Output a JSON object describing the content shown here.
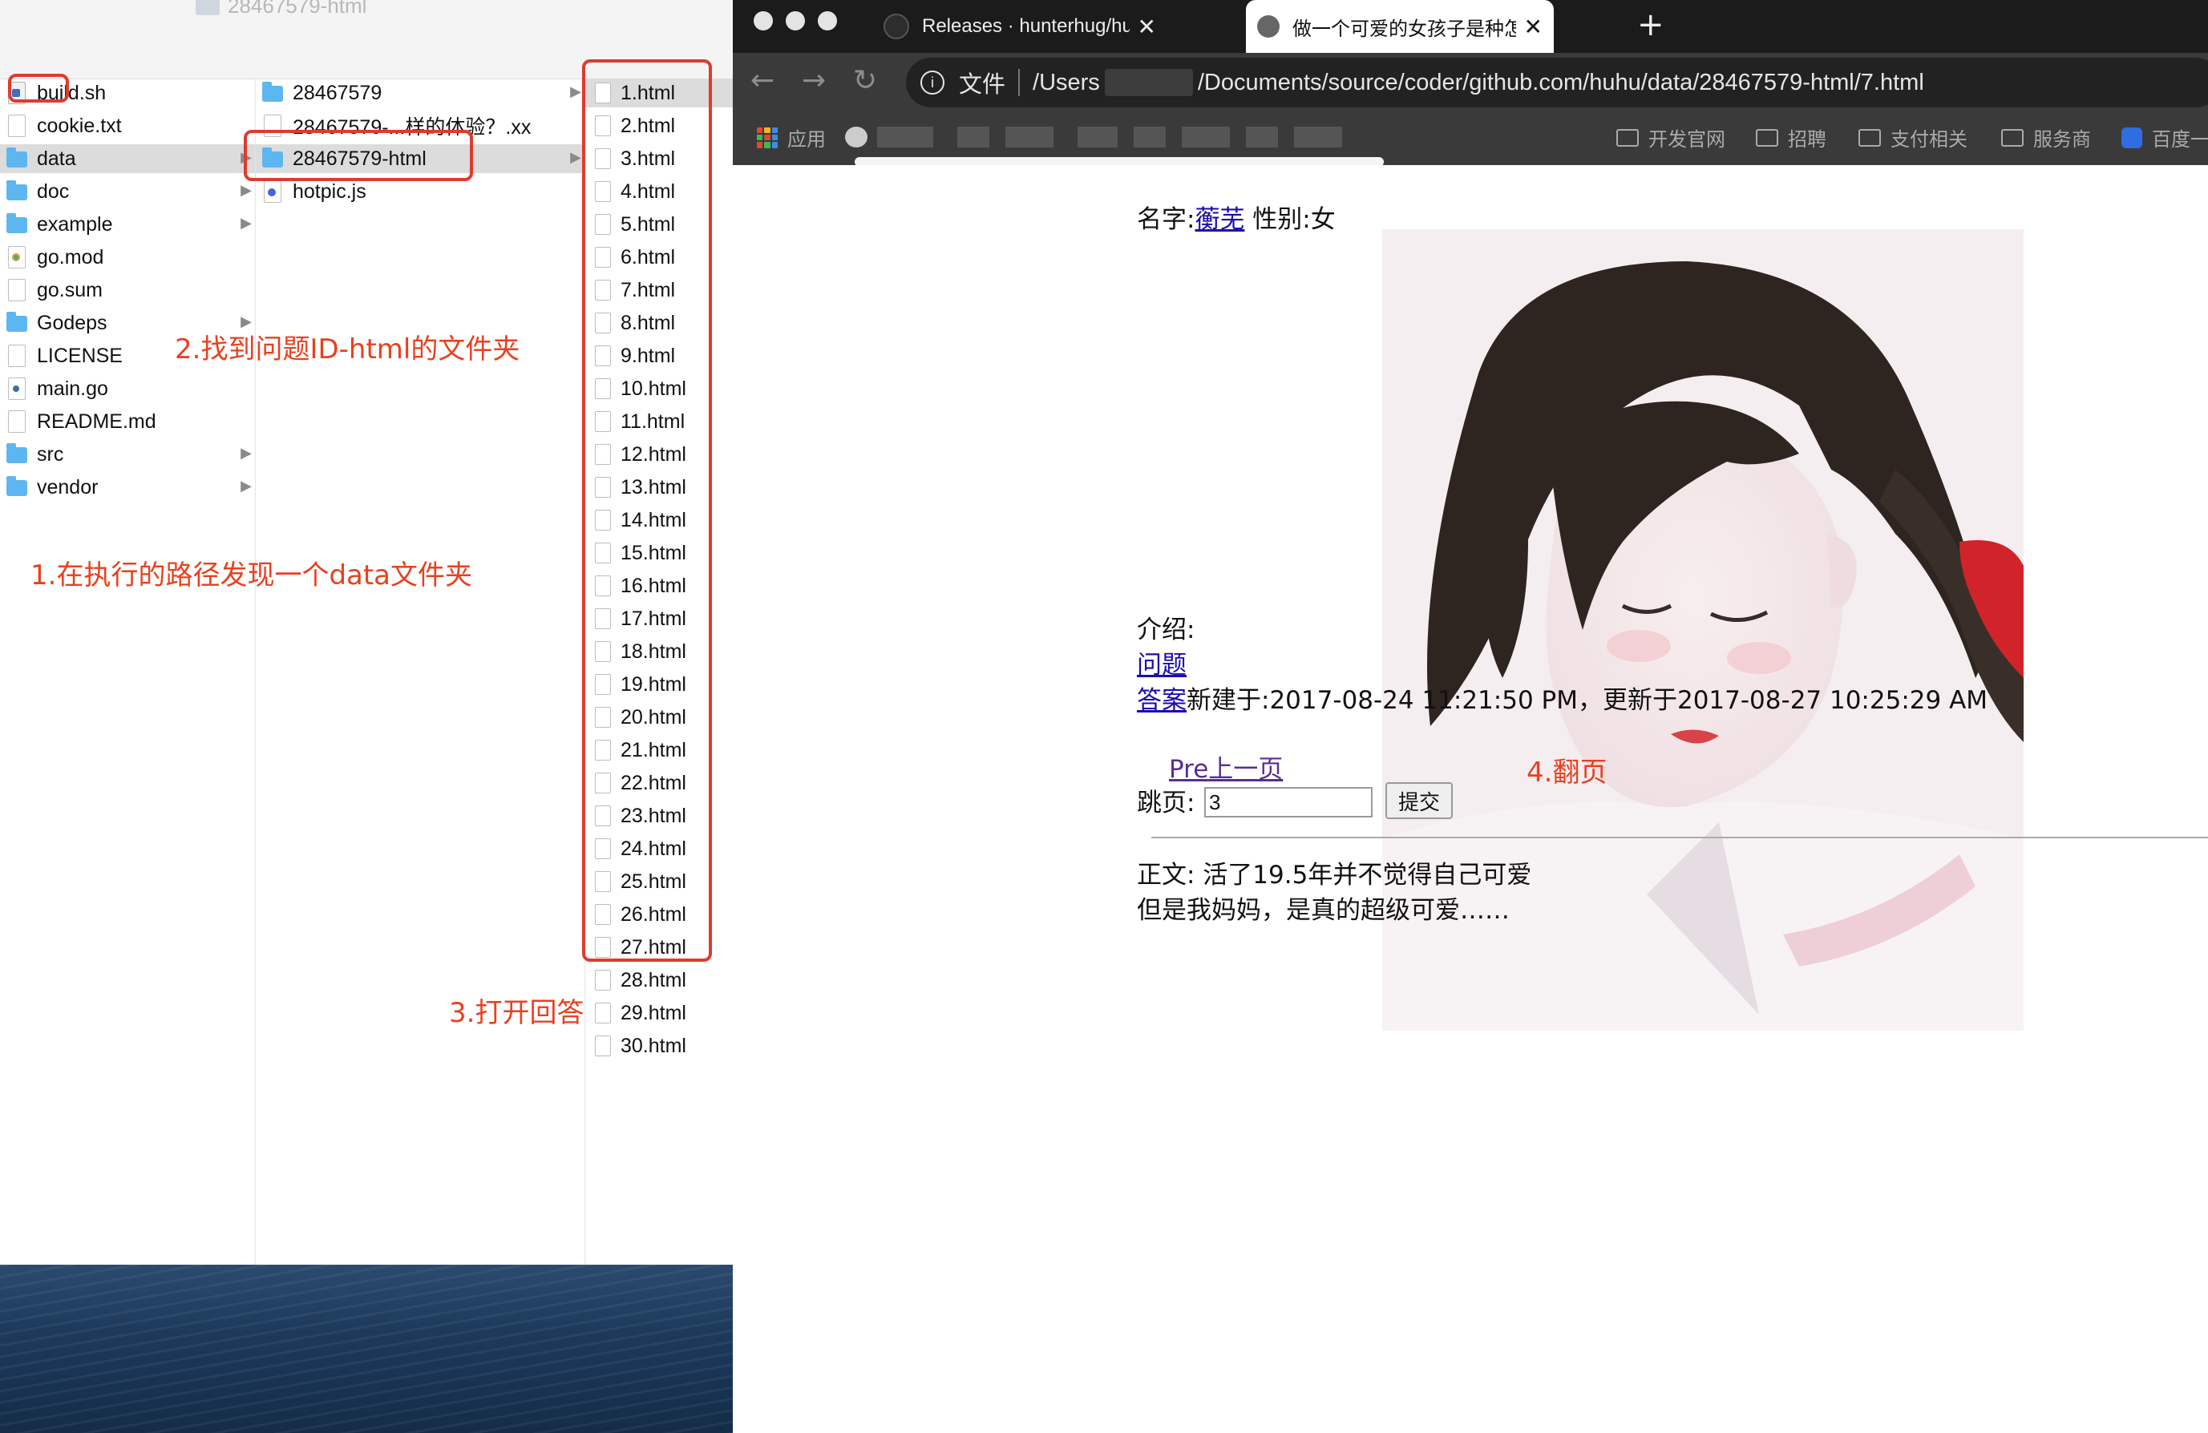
{
  "finder": {
    "title": "28467579-html",
    "col1": [
      {
        "name": "build.sh",
        "kind": "sh"
      },
      {
        "name": "cookie.txt",
        "kind": "file"
      },
      {
        "name": "data",
        "kind": "folder",
        "selected": true,
        "chevron": true
      },
      {
        "name": "doc",
        "kind": "folder",
        "chevron": true
      },
      {
        "name": "example",
        "kind": "folder",
        "chevron": true
      },
      {
        "name": "go.mod",
        "kind": "go"
      },
      {
        "name": "go.sum",
        "kind": "file"
      },
      {
        "name": "Godeps",
        "kind": "folder",
        "chevron": true
      },
      {
        "name": "LICENSE",
        "kind": "file"
      },
      {
        "name": "main.go",
        "kind": "gofile"
      },
      {
        "name": "README.md",
        "kind": "file"
      },
      {
        "name": "src",
        "kind": "folder",
        "chevron": true
      },
      {
        "name": "vendor",
        "kind": "folder",
        "chevron": true
      }
    ],
    "col2": [
      {
        "name": "28467579",
        "kind": "folder",
        "chevron": true
      },
      {
        "name": "28467579-...样的体验？.xx",
        "kind": "file"
      },
      {
        "name": "28467579-html",
        "kind": "folder",
        "selected": true,
        "chevron": true
      },
      {
        "name": "hotpic.js",
        "kind": "js"
      }
    ],
    "col3": [
      "1.html",
      "2.html",
      "3.html",
      "4.html",
      "5.html",
      "6.html",
      "7.html",
      "8.html",
      "9.html",
      "10.html",
      "11.html",
      "12.html",
      "13.html",
      "14.html",
      "15.html",
      "16.html",
      "17.html",
      "18.html",
      "19.html",
      "20.html",
      "21.html",
      "22.html",
      "23.html",
      "24.html",
      "25.html",
      "26.html",
      "27.html",
      "28.html",
      "29.html",
      "30.html"
    ]
  },
  "annotations": {
    "step1": "1.在执行的路径发现一个data文件夹",
    "step2": "2.找到问题ID-html的文件夹",
    "step3": "3.打开回答",
    "step4": "4.翻页",
    "color": "#e8411f"
  },
  "browser": {
    "tabs": [
      {
        "title": "Releases · hunterhug/huhu",
        "close": "✕",
        "icon": "github-icon"
      },
      {
        "title": "做一个可爱的女孩子是种怎样的体验",
        "close": "✕",
        "icon": "globe-icon"
      }
    ],
    "new_tab": "+",
    "address": {
      "info": "i",
      "scheme_label": "文件",
      "path_start": "/Users",
      "path_end": "/Documents/source/coder/github.com/huhu/data/28467579-html/7.html"
    },
    "bookmarks": [
      {
        "label": "应用",
        "icon": "apps-grid-icon"
      },
      {
        "label": "开发官网",
        "icon": "folder-icon"
      },
      {
        "label": "招聘",
        "icon": "folder-icon"
      },
      {
        "label": "支付相关",
        "icon": "folder-icon"
      },
      {
        "label": "服务商",
        "icon": "folder-icon"
      },
      {
        "label": "百度一",
        "icon": "baidu-icon"
      }
    ]
  },
  "page": {
    "name_label": "名字:",
    "name_value": "蘅芜",
    "gender": " 性别:女",
    "intro_label": "介绍:",
    "question_link": "问题",
    "answer_link": "答案",
    "answer_meta": "新建于:2017-08-24 11:21:50 PM，更新于2017-08-27 10:25:29 AM",
    "prev_link": "Pre上一页",
    "jump_label": "跳页:",
    "jump_value": "3",
    "submit_label": "提交",
    "body_line1": "正文: 活了19.5年并不觉得自己可爱",
    "body_line2": "但是我妈妈，是真的超级可爱……"
  }
}
